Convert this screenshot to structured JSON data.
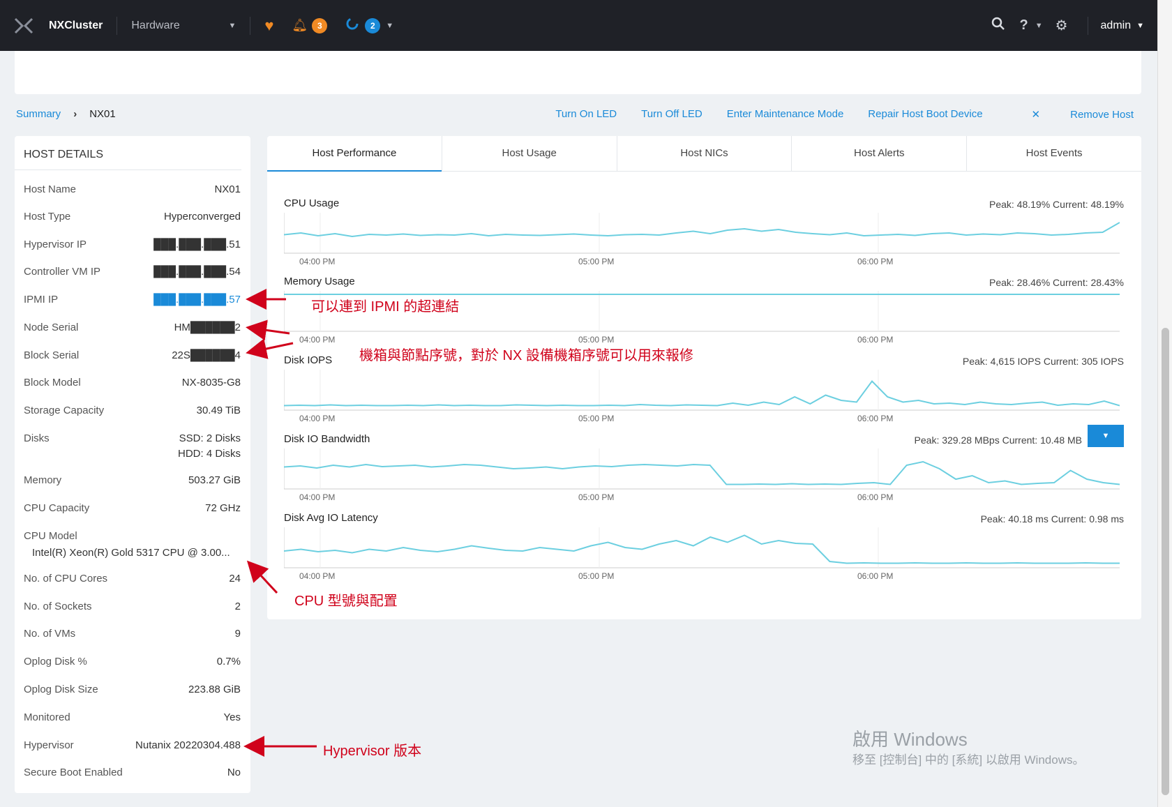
{
  "topbar": {
    "cluster_name": "NXCluster",
    "view_select": "Hardware",
    "alerts_count": "3",
    "tasks_count": "2",
    "user": "admin",
    "icons": [
      "nutanix-logo-icon",
      "health-heart-icon",
      "alert-bell-icon",
      "task-ring-icon",
      "search-icon",
      "help-icon",
      "gear-icon"
    ]
  },
  "breadcrumb": {
    "root": "Summary",
    "current": "NX01"
  },
  "actions": [
    "Turn On LED",
    "Turn Off LED",
    "Enter Maintenance Mode",
    "Repair Host Boot Device",
    "Remove Host"
  ],
  "host_details": {
    "title": "HOST DETAILS",
    "rows": [
      {
        "label": "Host Name",
        "value": "NX01"
      },
      {
        "label": "Host Type",
        "value": "Hyperconverged"
      },
      {
        "label": "Hypervisor IP",
        "value": "███.███.███.51"
      },
      {
        "label": "Controller VM IP",
        "value": "███.███.███.54"
      },
      {
        "label": "IPMI IP",
        "value": "███.███.███.57"
      },
      {
        "label": "Node Serial",
        "value": "HM██████2"
      },
      {
        "label": "Block Serial",
        "value": "22S██████4"
      },
      {
        "label": "Block Model",
        "value": "NX-8035-G8"
      },
      {
        "label": "Storage Capacity",
        "value": "30.49 TiB"
      },
      {
        "label": "Disks",
        "value": "SSD: 2 Disks",
        "value2": "HDD: 4 Disks"
      },
      {
        "label": "Memory",
        "value": "503.27 GiB"
      },
      {
        "label": "CPU Capacity",
        "value": "72 GHz"
      },
      {
        "label": "CPU Model",
        "value": "Intel(R) Xeon(R) Gold 5317 CPU @ 3.00..."
      },
      {
        "label": "No. of CPU Cores",
        "value": "24"
      },
      {
        "label": "No. of Sockets",
        "value": "2"
      },
      {
        "label": "No. of VMs",
        "value": "9"
      },
      {
        "label": "Oplog Disk %",
        "value": "0.7%"
      },
      {
        "label": "Oplog Disk Size",
        "value": "223.88 GiB"
      },
      {
        "label": "Monitored",
        "value": "Yes"
      },
      {
        "label": "Hypervisor",
        "value": "Nutanix 20220304.488"
      },
      {
        "label": "Secure Boot Enabled",
        "value": "No"
      }
    ]
  },
  "tabs": [
    "Host Performance",
    "Host Usage",
    "Host NICs",
    "Host Alerts",
    "Host Events"
  ],
  "charts": [
    {
      "title": "CPU Usage",
      "peak": "Peak: 48.19%   Current: 48.19%",
      "ticks": [
        "04:00 PM",
        "05:00 PM",
        "06:00 PM"
      ],
      "values": [
        0.45,
        0.5,
        0.42,
        0.48,
        0.4,
        0.46,
        0.44,
        0.47,
        0.43,
        0.45,
        0.44,
        0.48,
        0.42,
        0.46,
        0.44,
        0.43,
        0.45,
        0.47,
        0.44,
        0.42,
        0.45,
        0.46,
        0.44,
        0.5,
        0.55,
        0.48,
        0.58,
        0.62,
        0.55,
        0.6,
        0.52,
        0.48,
        0.45,
        0.5,
        0.42,
        0.44,
        0.46,
        0.43,
        0.48,
        0.5,
        0.44,
        0.47,
        0.45,
        0.5,
        0.48,
        0.44,
        0.46,
        0.5,
        0.52,
        0.8
      ]
    },
    {
      "title": "Memory Usage",
      "peak": "Peak: 28.46%   Current: 28.43%",
      "ticks": [
        "04:00 PM",
        "05:00 PM",
        "06:00 PM"
      ],
      "values": [
        0.98,
        0.98,
        0.98,
        0.98,
        0.98,
        0.98,
        0.98,
        0.98,
        0.98,
        0.98,
        0.98,
        0.98,
        0.98,
        0.98,
        0.98,
        0.98,
        0.98,
        0.98,
        0.98,
        0.98
      ]
    },
    {
      "title": "Disk IOPS",
      "peak": "Peak: 4,615 IOPS   Current: 305 IOPS",
      "ticks": [
        "04:00 PM",
        "05:00 PM",
        "06:00 PM"
      ],
      "values": [
        0.05,
        0.06,
        0.05,
        0.07,
        0.05,
        0.06,
        0.05,
        0.05,
        0.06,
        0.05,
        0.07,
        0.05,
        0.06,
        0.05,
        0.05,
        0.07,
        0.06,
        0.05,
        0.06,
        0.05,
        0.05,
        0.06,
        0.05,
        0.08,
        0.06,
        0.05,
        0.07,
        0.06,
        0.05,
        0.12,
        0.06,
        0.15,
        0.08,
        0.3,
        0.1,
        0.35,
        0.2,
        0.15,
        0.75,
        0.3,
        0.15,
        0.2,
        0.1,
        0.12,
        0.08,
        0.15,
        0.1,
        0.08,
        0.12,
        0.15,
        0.06,
        0.1,
        0.08,
        0.18,
        0.05
      ]
    },
    {
      "title": "Disk IO Bandwidth",
      "peak": "Peak: 329.28 MBps   Current: 10.48 MB",
      "ticks": [
        "04:00 PM",
        "05:00 PM",
        "06:00 PM"
      ],
      "values": [
        0.55,
        0.58,
        0.52,
        0.6,
        0.55,
        0.62,
        0.56,
        0.58,
        0.6,
        0.55,
        0.58,
        0.62,
        0.6,
        0.55,
        0.5,
        0.52,
        0.55,
        0.5,
        0.55,
        0.58,
        0.56,
        0.6,
        0.62,
        0.6,
        0.58,
        0.62,
        0.6,
        0.05,
        0.05,
        0.06,
        0.05,
        0.07,
        0.05,
        0.06,
        0.05,
        0.08,
        0.1,
        0.05,
        0.6,
        0.7,
        0.5,
        0.2,
        0.3,
        0.1,
        0.15,
        0.05,
        0.08,
        0.1,
        0.45,
        0.2,
        0.1,
        0.05
      ]
    },
    {
      "title": "Disk Avg IO Latency",
      "peak": "Peak: 40.18 ms   Current: 0.98 ms",
      "ticks": [
        "04:00 PM",
        "05:00 PM",
        "06:00 PM"
      ],
      "values": [
        0.4,
        0.45,
        0.38,
        0.42,
        0.35,
        0.45,
        0.4,
        0.5,
        0.42,
        0.38,
        0.45,
        0.55,
        0.48,
        0.42,
        0.4,
        0.5,
        0.45,
        0.4,
        0.55,
        0.65,
        0.5,
        0.45,
        0.6,
        0.7,
        0.55,
        0.8,
        0.65,
        0.85,
        0.6,
        0.7,
        0.62,
        0.6,
        0.1,
        0.05,
        0.06,
        0.05,
        0.05,
        0.06,
        0.05,
        0.05,
        0.06,
        0.05,
        0.05,
        0.06,
        0.05,
        0.05,
        0.05,
        0.06,
        0.05,
        0.05
      ]
    }
  ],
  "annotations": {
    "ipmi": "可以連到 IPMI 的超連結",
    "serial": "機箱與節點序號，對於 NX 設備機箱序號可以用來報修",
    "cpu": "CPU 型號與配置",
    "hypervisor": "Hypervisor 版本"
  },
  "watermark": {
    "line1": "啟用 Windows",
    "line2": "移至 [控制台] 中的 [系統] 以啟用 Windows。"
  },
  "colors": {
    "accent": "#1a8ad8",
    "chart_line": "#6ccfe0",
    "annotation": "#d0021b",
    "topbar": "#1f2127",
    "alert_badge": "#f08a24"
  }
}
